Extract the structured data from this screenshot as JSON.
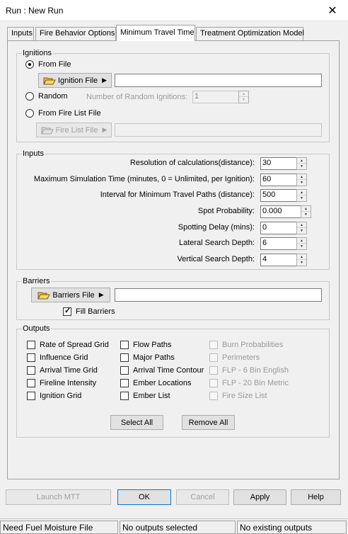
{
  "window": {
    "title": "Run : New Run",
    "close_glyph": "✕"
  },
  "tabs": [
    {
      "label": "Inputs"
    },
    {
      "label": "Fire Behavior Options"
    },
    {
      "label": "Minimum Travel Time"
    },
    {
      "label": "Treatment Optimization Model"
    }
  ],
  "ignitions": {
    "title": "Ignitions",
    "from_file": {
      "label": "From File",
      "checked": true,
      "button": "Ignition File",
      "icon": "folder-open-icon"
    },
    "random": {
      "label": "Random",
      "count_label": "Number of Random Ignitions:",
      "count_value": "1"
    },
    "fire_list": {
      "label": "From Fire List File",
      "button": "Fire List File",
      "icon": "folder-open-icon"
    }
  },
  "inputs": {
    "title": "Inputs",
    "rows": [
      {
        "label": "Resolution of calculations(distance):",
        "value": "30"
      },
      {
        "label": "Maximum Simulation Time (minutes, 0 = Unlimited, per Ignition):",
        "value": "60"
      },
      {
        "label": "Interval for Minimum Travel Paths (distance):",
        "value": "500"
      },
      {
        "label": "Spot Probability:",
        "value": "0.000"
      },
      {
        "label": "Spotting Delay (mins):",
        "value": "0"
      },
      {
        "label": "Lateral Search Depth:",
        "value": "6"
      },
      {
        "label": "Vertical Search Depth:",
        "value": "4"
      }
    ]
  },
  "barriers": {
    "title": "Barriers",
    "button": "Barriers File",
    "fill_label": "Fill Barriers",
    "fill_checked": true
  },
  "outputs": {
    "title": "Outputs",
    "col1": [
      "Rate of Spread Grid",
      "Influence Grid",
      "Arrival Time Grid",
      "Fireline Intensity",
      "Ignition Grid"
    ],
    "col2": [
      "Flow Paths",
      "Major Paths",
      "Arrival Time Contour",
      "Ember Locations",
      "Ember List"
    ],
    "col3": [
      "Burn Probabilities",
      "Perimeters",
      "FLP - 6 Bin English",
      "FLP - 20 Bin Metric",
      "Fire Size List"
    ],
    "select_all": "Select All",
    "remove_all": "Remove All"
  },
  "footer": {
    "launch": "Launch MTT",
    "ok": "OK",
    "cancel": "Cancel",
    "apply": "Apply",
    "help": "Help"
  },
  "status": {
    "cell1": "Need Fuel Moisture File",
    "cell2": "No outputs selected",
    "cell3": "No existing outputs"
  }
}
